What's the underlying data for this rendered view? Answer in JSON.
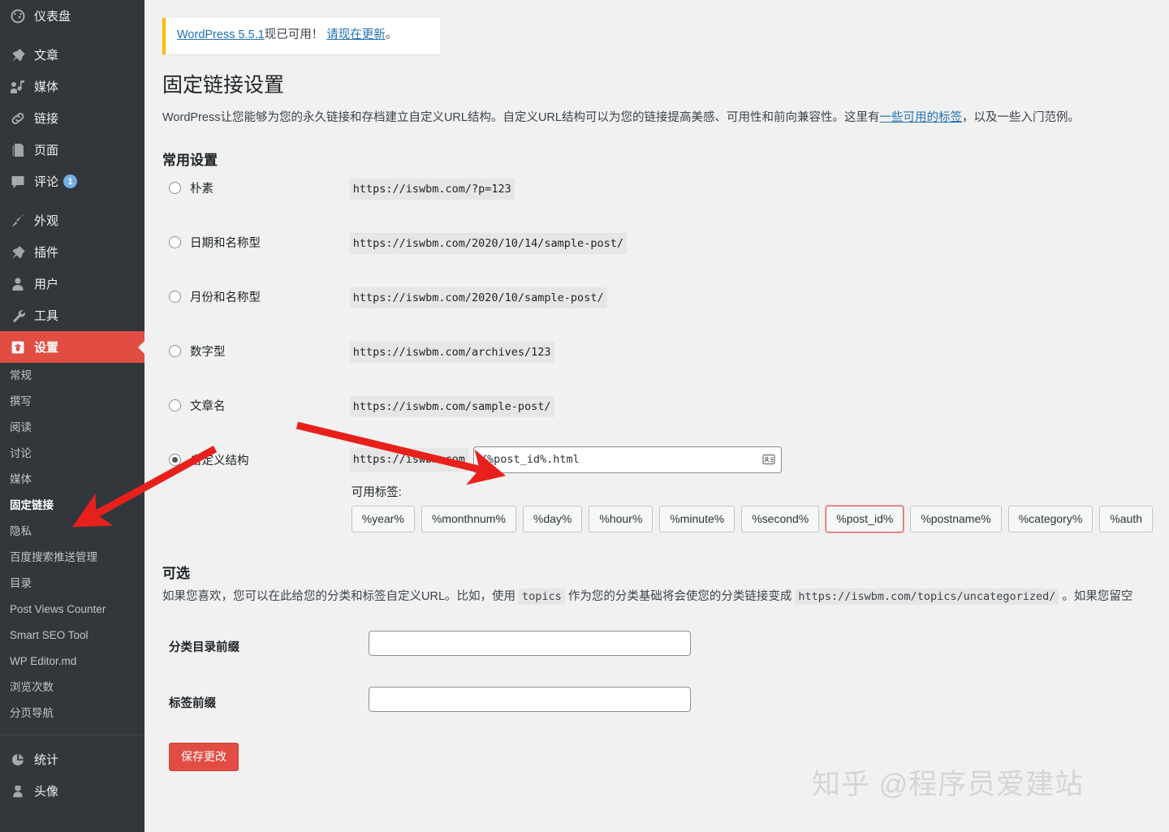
{
  "sidebar": {
    "top_items": [
      {
        "label": "仪表盘",
        "icon": "dashboard-icon",
        "badge": null,
        "current": false,
        "sep_after": true
      },
      {
        "label": "文章",
        "icon": "pin-icon",
        "badge": null,
        "current": false,
        "sep_after": false
      },
      {
        "label": "媒体",
        "icon": "media-icon",
        "badge": null,
        "current": false,
        "sep_after": false
      },
      {
        "label": "链接",
        "icon": "link-icon",
        "badge": null,
        "current": false,
        "sep_after": false
      },
      {
        "label": "页面",
        "icon": "page-icon",
        "badge": null,
        "current": false,
        "sep_after": false
      },
      {
        "label": "评论",
        "icon": "comment-icon",
        "badge": "1",
        "current": false,
        "sep_after": true
      },
      {
        "label": "外观",
        "icon": "appearance-icon",
        "badge": null,
        "current": false,
        "sep_after": false
      },
      {
        "label": "插件",
        "icon": "plugin-icon",
        "badge": null,
        "current": false,
        "sep_after": false
      },
      {
        "label": "用户",
        "icon": "user-icon",
        "badge": null,
        "current": false,
        "sep_after": false
      },
      {
        "label": "工具",
        "icon": "tools-icon",
        "badge": null,
        "current": false,
        "sep_after": false
      },
      {
        "label": "设置",
        "icon": "settings-icon",
        "badge": null,
        "current": true,
        "sep_after": false
      }
    ],
    "submenu": [
      {
        "label": "常规",
        "current": false
      },
      {
        "label": "撰写",
        "current": false
      },
      {
        "label": "阅读",
        "current": false
      },
      {
        "label": "讨论",
        "current": false
      },
      {
        "label": "媒体",
        "current": false
      },
      {
        "label": "固定链接",
        "current": true
      },
      {
        "label": "隐私",
        "current": false
      },
      {
        "label": "百度搜索推送管理",
        "current": false
      },
      {
        "label": "目录",
        "current": false
      },
      {
        "label": "Post Views Counter",
        "current": false
      },
      {
        "label": "Smart SEO Tool",
        "current": false
      },
      {
        "label": "WP Editor.md",
        "current": false
      },
      {
        "label": "浏览次数",
        "current": false
      },
      {
        "label": "分页导航",
        "current": false
      }
    ],
    "bottom_items": [
      {
        "label": "统计",
        "icon": "chart-pie-icon"
      },
      {
        "label": "头像",
        "icon": "avatar-icon"
      }
    ]
  },
  "notice": {
    "link_version": "WordPress 5.5.1",
    "text_middle": "现已可用！ ",
    "link_update": "请现在更新",
    "text_end": "。"
  },
  "page": {
    "title": "固定链接设置",
    "intro_part1": "WordPress让您能够为您的永久链接和存档建立自定义URL结构。自定义URL结构可以为您的链接提高美感、可用性和前向兼容性。这里有",
    "intro_link": "一些可用的标签",
    "intro_part2": "，以及一些入门范例。",
    "section_common": "常用设置",
    "avail_tags_label": "可用标签:",
    "optional_title": "可选",
    "optional_part1": "如果您喜欢，您可以在此给您的分类和标签自定义URL。比如，使用 ",
    "optional_code1": "topics",
    "optional_part2": " 作为您的分类基础将会使您的分类链接变成 ",
    "optional_code2": "https://iswbm.com/topics/uncategorized/",
    "optional_part3": " 。如果您留空"
  },
  "permalinks": [
    {
      "label": "朴素",
      "url": "https://iswbm.com/?p=123",
      "checked": false
    },
    {
      "label": "日期和名称型",
      "url": "https://iswbm.com/2020/10/14/sample-post/",
      "checked": false
    },
    {
      "label": "月份和名称型",
      "url": "https://iswbm.com/2020/10/sample-post/",
      "checked": false
    },
    {
      "label": "数字型",
      "url": "https://iswbm.com/archives/123",
      "checked": false
    },
    {
      "label": "文章名",
      "url": "https://iswbm.com/sample-post/",
      "checked": false
    }
  ],
  "custom_structure": {
    "label": "自定义结构",
    "checked": true,
    "prefix": "https://iswbm.com",
    "value": "/%post_id%.html",
    "placeholder": ""
  },
  "tags": [
    {
      "label": "%year%",
      "highlight": false
    },
    {
      "label": "%monthnum%",
      "highlight": false
    },
    {
      "label": "%day%",
      "highlight": false
    },
    {
      "label": "%hour%",
      "highlight": false
    },
    {
      "label": "%minute%",
      "highlight": false
    },
    {
      "label": "%second%",
      "highlight": false
    },
    {
      "label": "%post_id%",
      "highlight": true
    },
    {
      "label": "%postname%",
      "highlight": false
    },
    {
      "label": "%category%",
      "highlight": false
    },
    {
      "label": "%auth",
      "highlight": false
    }
  ],
  "fields": [
    {
      "label": "分类目录前缀",
      "value": "",
      "placeholder": ""
    },
    {
      "label": "标签前缀",
      "value": "",
      "placeholder": ""
    }
  ],
  "submit": {
    "label": "保存更改"
  },
  "watermark": {
    "text": "知乎 @程序员爱建站"
  },
  "colors": {
    "sidebar_bg": "#32373c",
    "accent_red": "#e14d43",
    "link_blue": "#2271b1",
    "notice_border": "#ffb900",
    "badge_blue": "#72aee6",
    "annotation_red": "#e8201c"
  }
}
